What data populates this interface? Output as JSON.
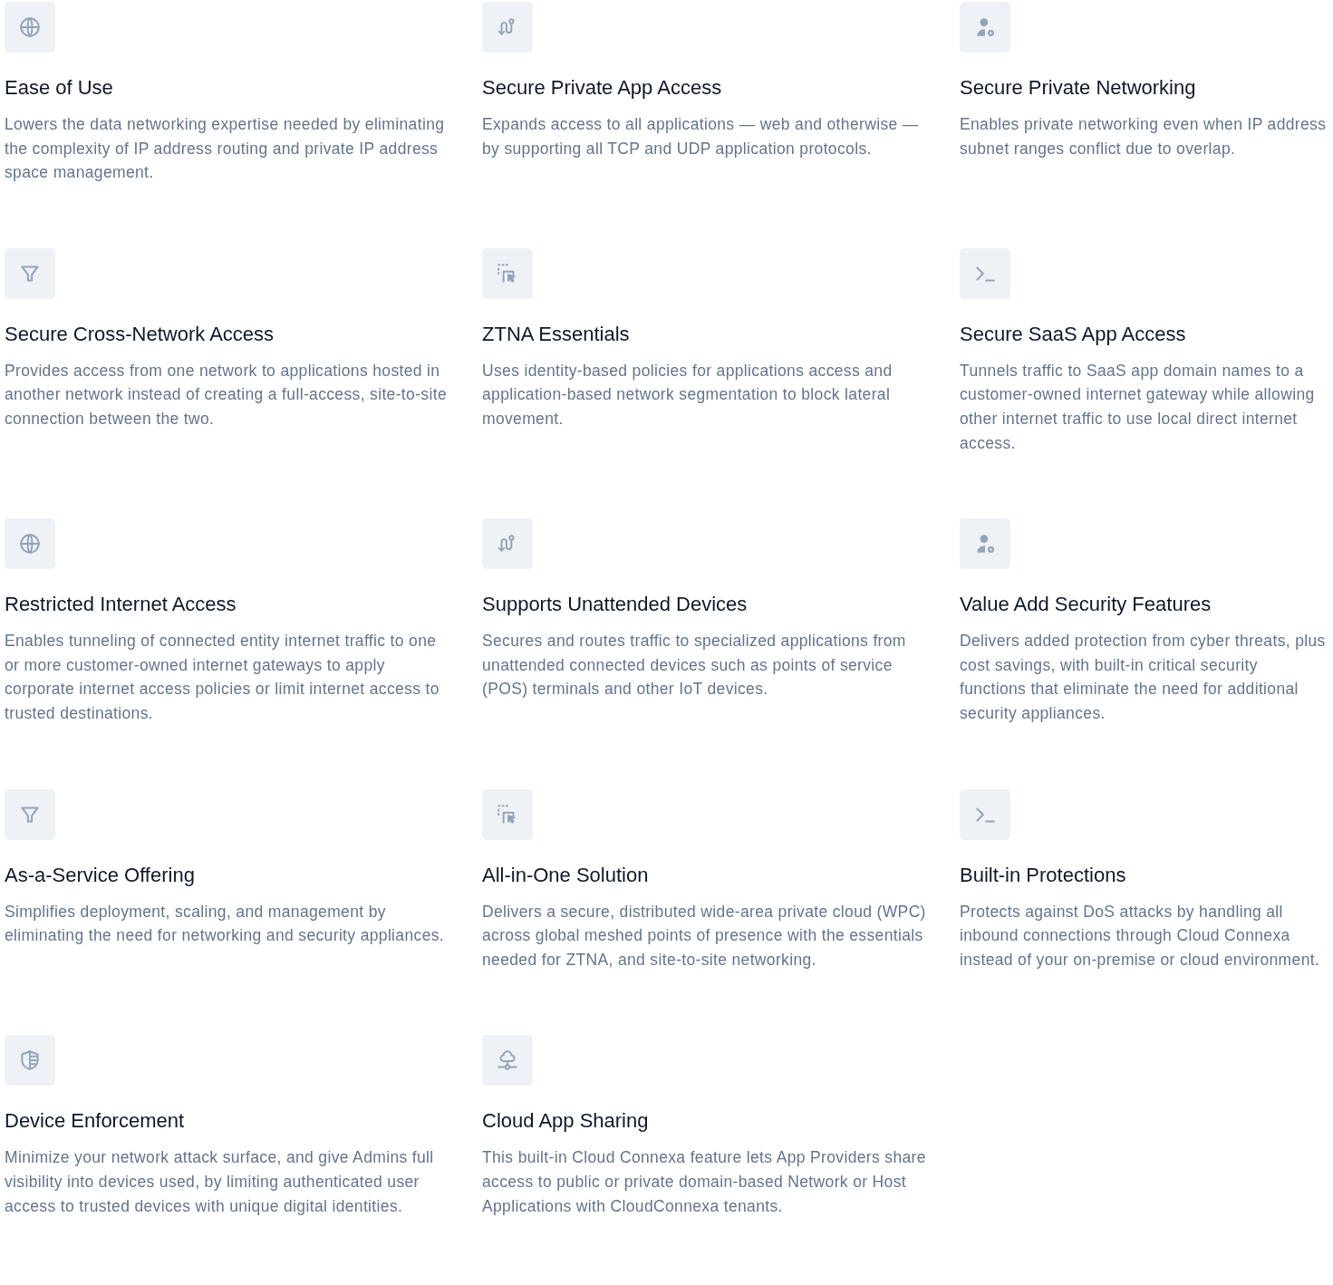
{
  "features": [
    {
      "kind": "globe",
      "title": "Ease of Use",
      "description": "Lowers the data networking expertise needed by eliminating the complexity of IP address routing and private IP address space management."
    },
    {
      "kind": "route",
      "title": "Secure Private App Access",
      "description": "Expands access to all applications — web and otherwise — by supporting all TCP and UDP application protocols."
    },
    {
      "kind": "user-gear",
      "title": "Secure Private Networking",
      "description": "Enables private networking even when IP address subnet ranges conflict due to overlap."
    },
    {
      "kind": "filter",
      "title": "Secure Cross-Network Access",
      "description": "Provides access from one network to applications hosted in another network instead of creating a full-access, site-to-site connection between the two."
    },
    {
      "kind": "select",
      "title": "ZTNA Essentials",
      "description": "Uses identity-based policies for applications access and application-based network segmentation to block lateral movement."
    },
    {
      "kind": "terminal",
      "title": "Secure SaaS App Access",
      "description": "Tunnels traffic to SaaS app domain names to a customer-owned internet gateway while allowing other internet traffic to use local direct internet access."
    },
    {
      "kind": "globe",
      "title": "Restricted Internet Access",
      "description": "Enables tunneling of connected entity internet traffic to one or more customer-owned internet gateways to apply corporate internet access policies or limit internet access to trusted destinations."
    },
    {
      "kind": "route",
      "title": "Supports Unattended Devices",
      "description": "Secures and routes traffic to specialized applications from unattended connected devices such as points of service (POS) terminals and other IoT devices."
    },
    {
      "kind": "user-gear",
      "title": "Value Add Security Features",
      "description": "Delivers added protection from cyber threats, plus cost savings, with built-in critical security functions that eliminate the need for additional security appliances."
    },
    {
      "kind": "filter",
      "title": "As-a-Service Offering",
      "description": "Simplifies deployment, scaling, and management by eliminating the need for networking and security appliances."
    },
    {
      "kind": "select",
      "title": "All-in-One Solution",
      "description": "Delivers a secure, distributed wide-area private cloud (WPC) across global meshed points of presence with the essentials needed for ZTNA, and site-to-site networking."
    },
    {
      "kind": "terminal",
      "title": "Built-in Protections",
      "description": "Protects against DoS attacks by handling all inbound connections through Cloud Connexa instead of your on-premise or cloud environment."
    },
    {
      "kind": "shield",
      "title": "Device Enforcement",
      "description": "Minimize your network attack surface, and give Admins full visibility into devices used, by limiting authenticated user access to trusted devices with unique digital identities."
    },
    {
      "kind": "cloud",
      "title": "Cloud App Sharing",
      "description": "This built-in Cloud Connexa feature lets App Providers share access to public or private domain-based Network or Host Applications with CloudConnexa tenants."
    }
  ]
}
